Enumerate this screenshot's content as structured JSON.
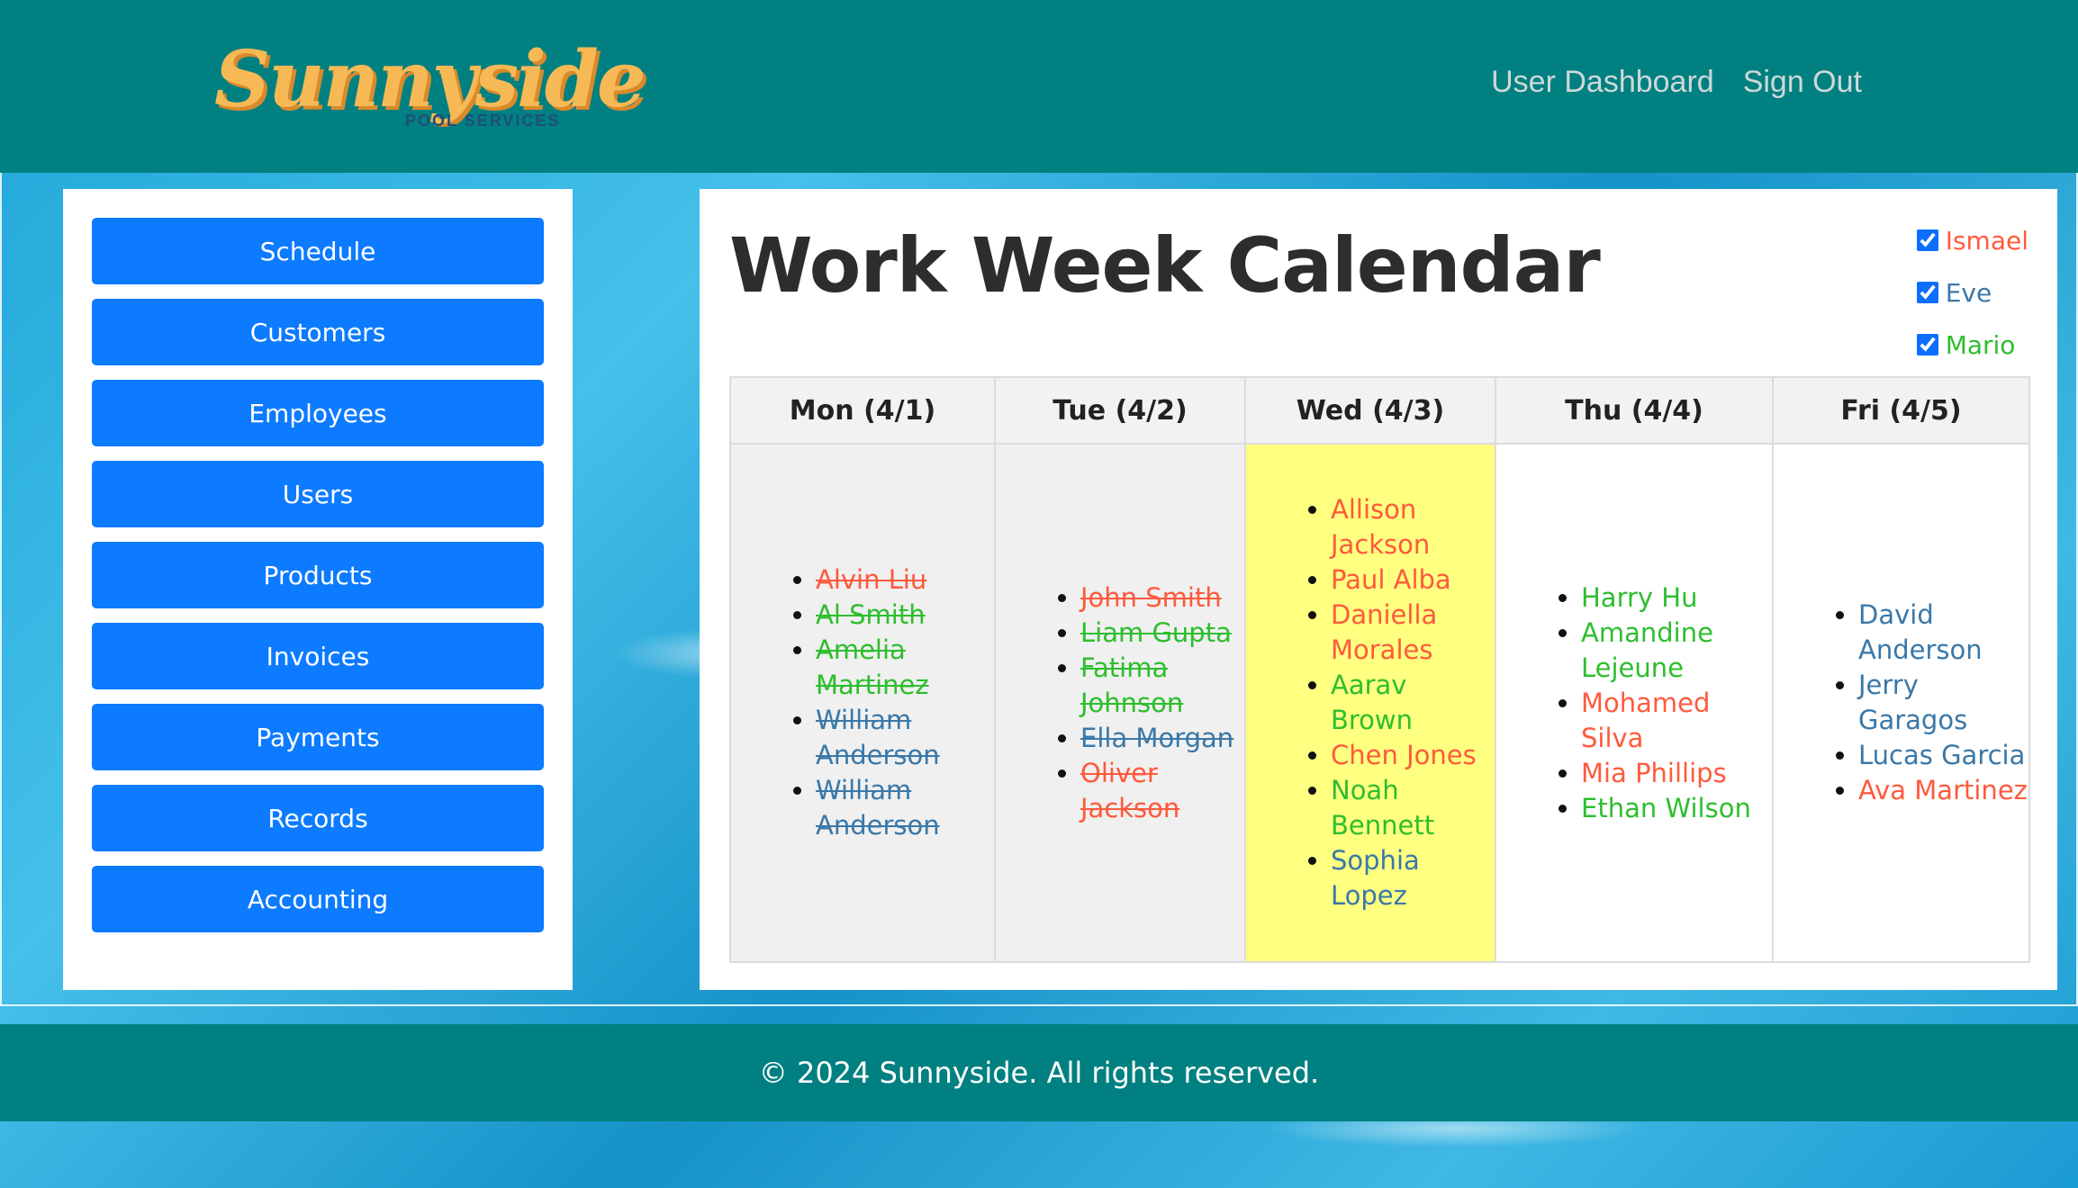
{
  "header": {
    "logo_text": "Sunnyside",
    "logo_sub": "POOL SERVICES",
    "nav": [
      "User Dashboard",
      "Sign Out"
    ]
  },
  "sidebar": {
    "items": [
      "Schedule",
      "Customers",
      "Employees",
      "Users",
      "Products",
      "Invoices",
      "Payments",
      "Records",
      "Accounting"
    ]
  },
  "main": {
    "title": "Work Week Calendar",
    "filters": [
      {
        "name": "Ismael",
        "checked": true,
        "color": "#ff5a3d"
      },
      {
        "name": "Eve",
        "checked": true,
        "color": "#3a78a8"
      },
      {
        "name": "Mario",
        "checked": true,
        "color": "#2ebe2e"
      }
    ],
    "days": [
      {
        "label": "Mon (4/1)",
        "state": "past",
        "entries": [
          {
            "name": "Alvin Liu",
            "employee": "Ismael"
          },
          {
            "name": "Al Smith",
            "employee": "Mario"
          },
          {
            "name": "Amelia Martinez",
            "employee": "Mario"
          },
          {
            "name": "William Anderson",
            "employee": "Eve"
          },
          {
            "name": "William Anderson",
            "employee": "Eve"
          }
        ]
      },
      {
        "label": "Tue (4/2)",
        "state": "past",
        "entries": [
          {
            "name": "John Smith",
            "employee": "Ismael"
          },
          {
            "name": "Liam Gupta",
            "employee": "Mario"
          },
          {
            "name": "Fatima Johnson",
            "employee": "Mario"
          },
          {
            "name": "Ella Morgan",
            "employee": "Eve"
          },
          {
            "name": "Oliver Jackson",
            "employee": "Ismael"
          }
        ]
      },
      {
        "label": "Wed (4/3)",
        "state": "today",
        "entries": [
          {
            "name": "Allison Jackson",
            "employee": "Ismael"
          },
          {
            "name": "Paul Alba",
            "employee": "Ismael"
          },
          {
            "name": "Daniella Morales",
            "employee": "Ismael"
          },
          {
            "name": "Aarav Brown",
            "employee": "Mario"
          },
          {
            "name": "Chen Jones",
            "employee": "Ismael"
          },
          {
            "name": "Noah Bennett",
            "employee": "Mario"
          },
          {
            "name": "Sophia Lopez",
            "employee": "Eve"
          }
        ]
      },
      {
        "label": "Thu (4/4)",
        "state": "future",
        "entries": [
          {
            "name": "Harry Hu",
            "employee": "Mario"
          },
          {
            "name": "Amandine Lejeune",
            "employee": "Mario"
          },
          {
            "name": "Mohamed Silva",
            "employee": "Ismael"
          },
          {
            "name": "Mia Phillips",
            "employee": "Ismael"
          },
          {
            "name": "Ethan Wilson",
            "employee": "Mario"
          }
        ]
      },
      {
        "label": "Fri (4/5)",
        "state": "future",
        "entries": [
          {
            "name": "David Anderson",
            "employee": "Eve"
          },
          {
            "name": "Jerry Garagos",
            "employee": "Eve"
          },
          {
            "name": "Lucas Garcia",
            "employee": "Eve"
          },
          {
            "name": "Ava Martinez",
            "employee": "Ismael"
          }
        ]
      }
    ]
  },
  "footer": {
    "text": "© 2024 Sunnyside. All rights reserved."
  },
  "colors": {
    "header_bg": "#008080",
    "button_bg": "#0d7bff",
    "today_bg": "#ffff80"
  }
}
